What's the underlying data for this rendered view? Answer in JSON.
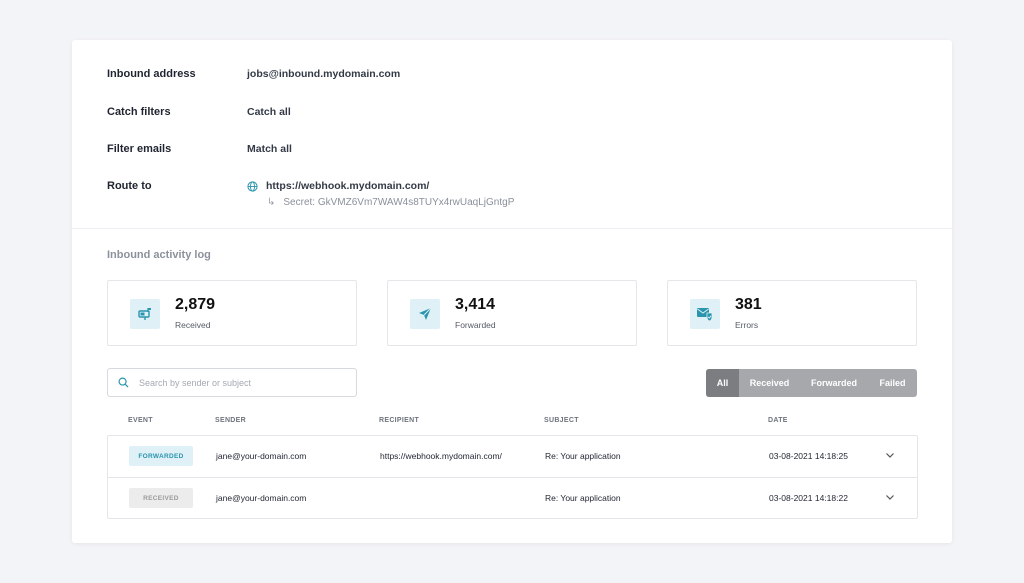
{
  "details": {
    "inbound_address": {
      "label": "Inbound address",
      "value": "jobs@inbound.mydomain.com"
    },
    "catch_filters": {
      "label": "Catch filters",
      "value": "Catch all"
    },
    "filter_emails": {
      "label": "Filter emails",
      "value": "Match all"
    },
    "route_to": {
      "label": "Route to",
      "value": "https://webhook.mydomain.com/",
      "secret": "Secret: GkVMZ6Vm7WAW4s8TUYx4rwUaqLjGntgP",
      "icon": "globe-icon"
    }
  },
  "activity": {
    "title": "Inbound activity log",
    "stats": [
      {
        "value": "2,879",
        "label": "Received",
        "icon": "mailbox-icon"
      },
      {
        "value": "3,414",
        "label": "Forwarded",
        "icon": "paper-plane-icon"
      },
      {
        "value": "381",
        "label": "Errors",
        "icon": "mail-shield-icon"
      }
    ]
  },
  "search": {
    "placeholder": "Search by sender or subject",
    "value": ""
  },
  "filters": [
    {
      "label": "All",
      "active": true
    },
    {
      "label": "Received",
      "active": false
    },
    {
      "label": "Forwarded",
      "active": false
    },
    {
      "label": "Failed",
      "active": false
    }
  ],
  "table": {
    "headers": {
      "event": "EVENT",
      "sender": "SENDER",
      "recipient": "RECIPIENT",
      "subject": "SUBJECT",
      "date": "DATE"
    },
    "rows": [
      {
        "event": "FORWARDED",
        "sender": "jane@your-domain.com",
        "recipient": "https://webhook.mydomain.com/",
        "subject": "Re: Your application",
        "date": "03-08-2021 14:18:25"
      },
      {
        "event": "RECEIVED",
        "sender": "jane@your-domain.com",
        "recipient": "",
        "subject": "Re: Your application",
        "date": "03-08-2021 14:18:22"
      }
    ]
  },
  "colors": {
    "accent": "#2a95ad",
    "accent_bg": "#dff1f6",
    "filter_active": "#7b7d80",
    "filter_bg": "#a6a8ab"
  }
}
